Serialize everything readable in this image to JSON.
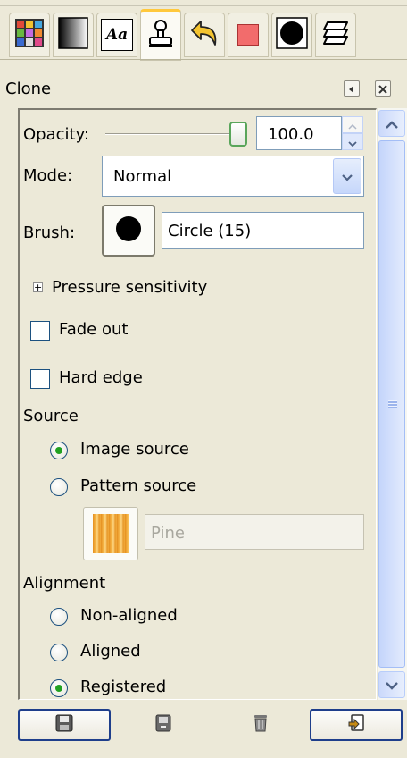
{
  "dock": {
    "tabs": [
      {
        "name": "patterns-tab",
        "icon": "patterns-icon"
      },
      {
        "name": "gradients-tab",
        "icon": "gradient-icon"
      },
      {
        "name": "fonts-tab",
        "icon": "font-icon",
        "glyph": "Aa"
      },
      {
        "name": "tool-options-tab",
        "icon": "clone-stamp-icon",
        "active": true
      },
      {
        "name": "undo-history-tab",
        "icon": "undo-history-icon"
      },
      {
        "name": "fg-color-tab",
        "icon": "color-swatch-icon"
      },
      {
        "name": "brushes-tab",
        "icon": "brush-circle-icon"
      },
      {
        "name": "layers-tab",
        "icon": "layers-icon"
      }
    ],
    "title": "Clone",
    "menu_icon": "tab-menu-icon",
    "close_icon": "close-icon"
  },
  "options": {
    "opacity_label": "Opacity:",
    "opacity_value": "100.0",
    "opacity_fraction": 1.0,
    "mode_label": "Mode:",
    "mode_value": "Normal",
    "brush_label": "Brush:",
    "brush_value": "Circle (15)",
    "pressure_label": "Pressure sensitivity",
    "fade_out_label": "Fade out",
    "fade_out_checked": false,
    "hard_edge_label": "Hard edge",
    "hard_edge_checked": false,
    "source_label": "Source",
    "source_options": [
      {
        "label": "Image source",
        "selected": true
      },
      {
        "label": "Pattern source",
        "selected": false
      }
    ],
    "pattern_value": "Pine",
    "alignment_label": "Alignment",
    "alignment_options": [
      {
        "label": "Non-aligned",
        "selected": false
      },
      {
        "label": "Aligned",
        "selected": false
      },
      {
        "label": "Registered",
        "selected": true
      }
    ]
  },
  "footer": {
    "buttons": [
      {
        "name": "save-options-button",
        "icon": "save-icon"
      },
      {
        "name": "restore-options-button",
        "icon": "restore-icon"
      },
      {
        "name": "delete-options-button",
        "icon": "trash-icon"
      },
      {
        "name": "reset-options-button",
        "icon": "reset-icon"
      }
    ]
  },
  "colors": {
    "accent_tab": "#ffc83c",
    "radio_on": "#21a121",
    "xp_blue": "#7f9db9"
  }
}
